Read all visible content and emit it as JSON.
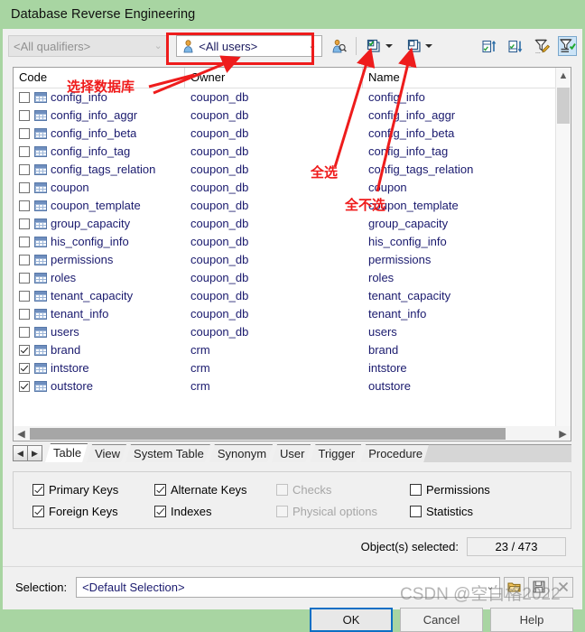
{
  "window": {
    "title": "Database Reverse Engineering",
    "titlebar_color": "#a8d5a2"
  },
  "toolbar": {
    "qualifier_combo": {
      "value": "<All qualifiers>",
      "enabled": false
    },
    "user_combo": {
      "value": "<All users>",
      "icon": "user-icon",
      "enabled": true
    },
    "buttons": [
      {
        "name": "user-filter-icon",
        "label": ""
      },
      {
        "name": "select-all-icon",
        "label": ""
      },
      {
        "name": "select-all-dropdown-arrow",
        "label": ""
      },
      {
        "name": "deselect-all-icon",
        "label": ""
      },
      {
        "name": "deselect-all-dropdown-arrow",
        "label": ""
      },
      {
        "name": "sort-ascending-icon",
        "label": ""
      },
      {
        "name": "sort-descending-icon",
        "label": ""
      },
      {
        "name": "edit-filter-icon",
        "label": ""
      },
      {
        "name": "apply-filter-icon",
        "label": ""
      }
    ]
  },
  "list": {
    "columns": [
      "Code",
      "Owner",
      "Name"
    ],
    "rows": [
      {
        "checked": false,
        "code": "config_info",
        "owner": "coupon_db",
        "name": "config_info"
      },
      {
        "checked": false,
        "code": "config_info_aggr",
        "owner": "coupon_db",
        "name": "config_info_aggr"
      },
      {
        "checked": false,
        "code": "config_info_beta",
        "owner": "coupon_db",
        "name": "config_info_beta"
      },
      {
        "checked": false,
        "code": "config_info_tag",
        "owner": "coupon_db",
        "name": "config_info_tag"
      },
      {
        "checked": false,
        "code": "config_tags_relation",
        "owner": "coupon_db",
        "name": "config_tags_relation"
      },
      {
        "checked": false,
        "code": "coupon",
        "owner": "coupon_db",
        "name": "coupon"
      },
      {
        "checked": false,
        "code": "coupon_template",
        "owner": "coupon_db",
        "name": "coupon_template"
      },
      {
        "checked": false,
        "code": "group_capacity",
        "owner": "coupon_db",
        "name": "group_capacity"
      },
      {
        "checked": false,
        "code": "his_config_info",
        "owner": "coupon_db",
        "name": "his_config_info"
      },
      {
        "checked": false,
        "code": "permissions",
        "owner": "coupon_db",
        "name": "permissions"
      },
      {
        "checked": false,
        "code": "roles",
        "owner": "coupon_db",
        "name": "roles"
      },
      {
        "checked": false,
        "code": "tenant_capacity",
        "owner": "coupon_db",
        "name": "tenant_capacity"
      },
      {
        "checked": false,
        "code": "tenant_info",
        "owner": "coupon_db",
        "name": "tenant_info"
      },
      {
        "checked": false,
        "code": "users",
        "owner": "coupon_db",
        "name": "users"
      },
      {
        "checked": true,
        "code": "brand",
        "owner": "crm",
        "name": "brand"
      },
      {
        "checked": true,
        "code": "intstore",
        "owner": "crm",
        "name": "intstore"
      },
      {
        "checked": true,
        "code": "outstore",
        "owner": "crm",
        "name": "outstore"
      }
    ]
  },
  "tabs": {
    "items": [
      "Table",
      "View",
      "System Table",
      "Synonym",
      "User",
      "Trigger",
      "Procedure"
    ],
    "selected": "Table"
  },
  "options": [
    {
      "label": "Primary Keys",
      "checked": true,
      "enabled": true
    },
    {
      "label": "Alternate Keys",
      "checked": true,
      "enabled": true
    },
    {
      "label": "Checks",
      "checked": false,
      "enabled": false
    },
    {
      "label": "Permissions",
      "checked": false,
      "enabled": true
    },
    {
      "label": "Foreign Keys",
      "checked": true,
      "enabled": true
    },
    {
      "label": "Indexes",
      "checked": true,
      "enabled": true
    },
    {
      "label": "Physical options",
      "checked": false,
      "enabled": false
    },
    {
      "label": "Statistics",
      "checked": false,
      "enabled": true
    }
  ],
  "status": {
    "objects_selected_label": "Object(s) selected:",
    "objects_selected_value": "23 / 473"
  },
  "selection": {
    "label": "Selection:",
    "value": "<Default Selection>",
    "buttons": [
      {
        "name": "open-folder-icon"
      },
      {
        "name": "save-icon"
      },
      {
        "name": "delete-icon"
      }
    ]
  },
  "dialog_buttons": [
    {
      "label": "OK",
      "name": "ok-button",
      "default": true
    },
    {
      "label": "Cancel",
      "name": "cancel-button",
      "default": false
    },
    {
      "label": "Help",
      "name": "help-button",
      "default": false
    }
  ],
  "annotations": {
    "select_database": "选择数据库",
    "select_all": "全选",
    "deselect_all": "全不选",
    "watermark": "CSDN @空白格2022",
    "color": "#ee1c1c"
  }
}
